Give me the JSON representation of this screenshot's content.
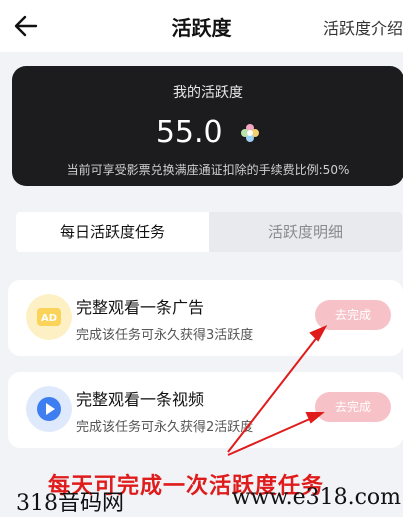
{
  "header": {
    "title": "活跃度",
    "intro_link": "活跃度介绍"
  },
  "summary": {
    "label": "我的活跃度",
    "value": "55.0",
    "description": "当前可享受影票兑换满座通证扣除的手续费比例:50%"
  },
  "tabs": [
    {
      "label": "每日活跃度任务",
      "active": true
    },
    {
      "label": "活跃度明细",
      "active": false
    }
  ],
  "tasks": [
    {
      "title": "完整观看一条广告",
      "subtitle": "完成该任务可永久获得3活跃度",
      "button": "去完成",
      "icon": "ad-icon",
      "icon_text": "AD"
    },
    {
      "title": "完整观看一条视频",
      "subtitle": "完成该任务可永久获得2活跃度",
      "button": "去完成",
      "icon": "play-icon"
    }
  ],
  "annotation": {
    "text": "每天可完成一次活跃度任务"
  },
  "watermark": {
    "left": "318音码网",
    "right": "www.e318.com"
  },
  "colors": {
    "card_bg": "#1c1c1e",
    "button_bg": "#f7c2c7",
    "annotation": "#e01b1b",
    "ad_icon": "#fbd35a",
    "play_icon": "#3f7ef1"
  }
}
